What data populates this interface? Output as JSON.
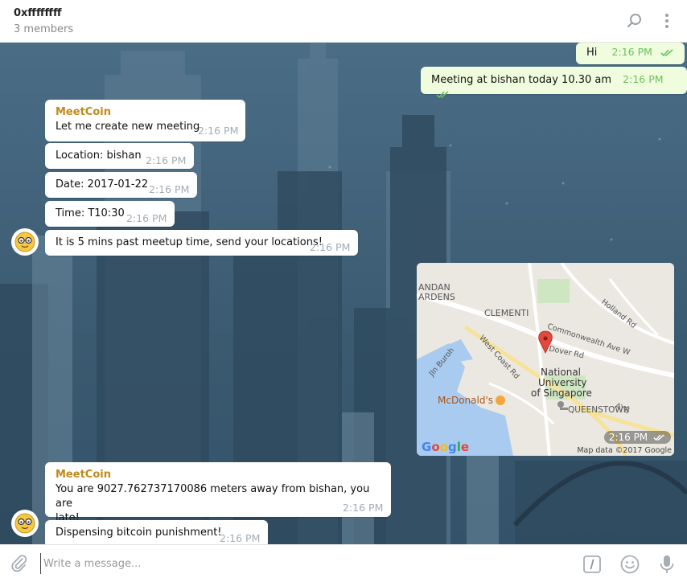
{
  "header": {
    "title": "0xffffffff",
    "subtitle": "3 members",
    "search_icon": "search-icon",
    "more_icon": "more-vertical-icon"
  },
  "messages": {
    "out1": {
      "text": "Hi",
      "time": "2:16 PM"
    },
    "out2": {
      "text": "Meeting at bishan today 10.30 am",
      "time": "2:16 PM"
    },
    "in1": {
      "sender": "MeetCoin",
      "text": "Let me create new meeting",
      "time": "2:16 PM"
    },
    "in2": {
      "text": "Location: bishan",
      "time": "2:16 PM"
    },
    "in3": {
      "text": "Date: 2017-01-22",
      "time": "2:16 PM"
    },
    "in4": {
      "text": "Time: T10:30",
      "time": "2:16 PM"
    },
    "in5": {
      "text": "It is 5 mins past meetup time, send your locations!",
      "time": "2:16 PM"
    },
    "map": {
      "time": "2:16 PM",
      "attribution": "Map data ©2017 Google",
      "logo": "Google",
      "labels": {
        "gardens_a": "ANDAN",
        "gardens_b": "ARDENS",
        "clementi": "CLEMENTI",
        "holland": "Holland Rd",
        "commonwealth": "Commonwealth Ave W",
        "dover": "Dover Rd",
        "westcoast": "West Coast Rd",
        "jlnburoh": "Jln Buroh",
        "nus1": "National",
        "nus2": "University",
        "nus3": "of Singapore",
        "mcd": "McDonald's",
        "queenstown": "QUEENSTOWN",
        "aye": "AYE"
      }
    },
    "in6": {
      "sender": "MeetCoin",
      "text_line1": "You are 9027.762737170086 meters away from bishan, you are",
      "text_line2": "late!",
      "time": "2:16 PM"
    },
    "in7": {
      "text": "Dispensing bitcoin punishment!",
      "time": "2:16 PM"
    }
  },
  "composer": {
    "placeholder": "Write a message...",
    "attach_icon": "paperclip-icon",
    "command_icon": "slash-command-icon",
    "emoji_icon": "emoji-icon",
    "mic_icon": "microphone-icon"
  },
  "colors": {
    "sender": "#c08a1a",
    "out_bubble": "#effdde",
    "check": "#6cbf5a",
    "chat_bg": "#3f627b"
  }
}
